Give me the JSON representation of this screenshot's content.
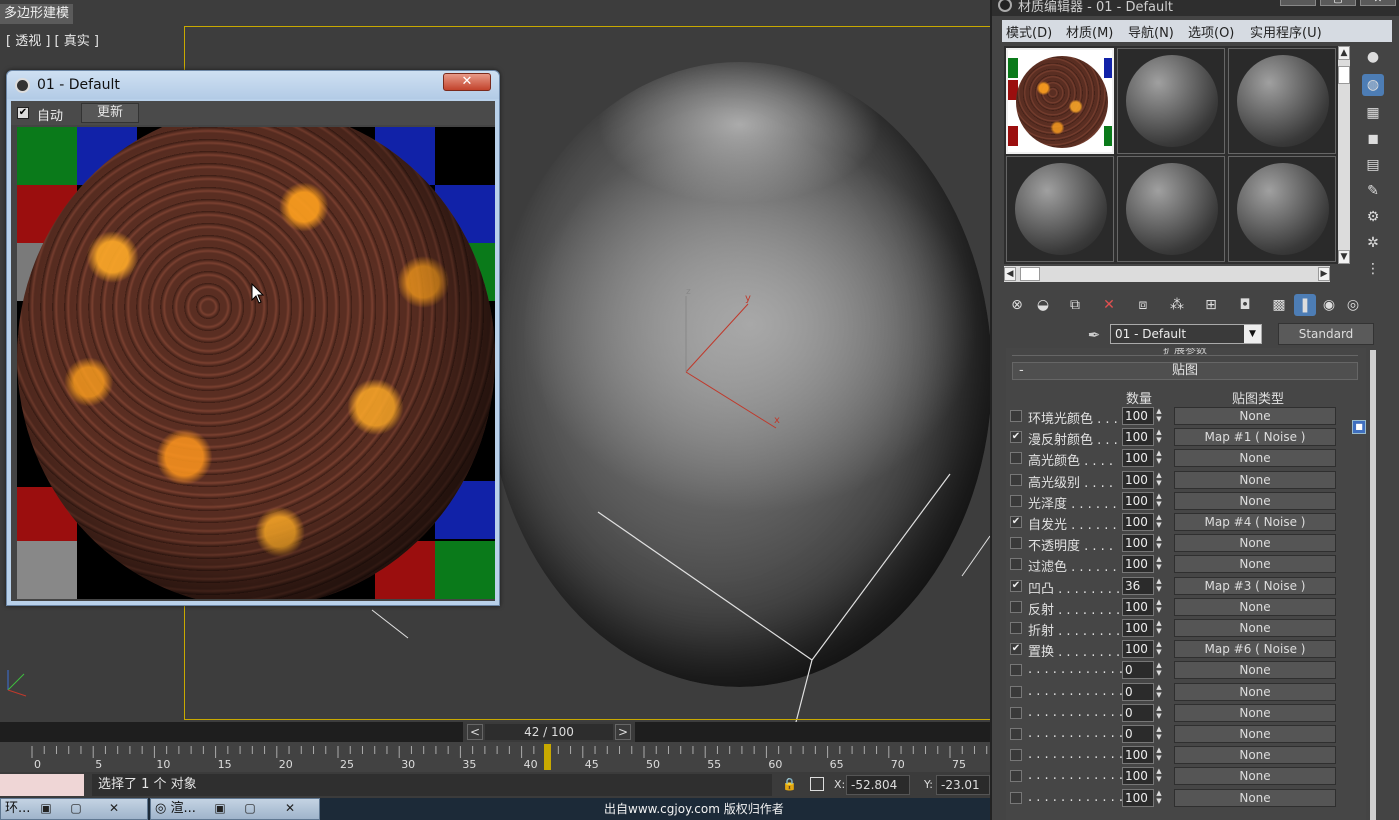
{
  "viewport": {
    "tab_label": "多边形建模",
    "view_label": "[ 透视 ] [ 真实 ]",
    "axis_labels": {
      "x": "x",
      "y": "y",
      "z": "z"
    }
  },
  "preview_window": {
    "title": "01 - Default",
    "close_label": "✕",
    "auto_label": "自动",
    "auto_checked": "✔",
    "update_label": "更新"
  },
  "timeline": {
    "prev": "<",
    "next": ">",
    "frame_display": "42 / 100",
    "current_frame": 42,
    "total_frames": 100,
    "ticks": [
      "0",
      "5",
      "10",
      "15",
      "20",
      "25",
      "30",
      "35",
      "40",
      "45",
      "50",
      "55",
      "60",
      "65",
      "70",
      "75"
    ]
  },
  "status": {
    "message": "选择了 1 个 对象",
    "x_label": "X:",
    "x_value": "-52.804",
    "y_label": "Y:",
    "y_value": "-23.01"
  },
  "taskbar": {
    "task1": "环...",
    "task2": "渲..."
  },
  "watermark": "出自www.cgjoy.com 版权归作者",
  "material_editor": {
    "title": "材质编辑器 - 01 - Default",
    "menus": [
      "模式(D)",
      "材质(M)",
      "导航(N)",
      "选项(O)",
      "实用程序(U)"
    ],
    "material_name": "01 - Default",
    "material_type": "Standard",
    "extended_params": "扩展参数",
    "maps_title": "贴图",
    "maps_collapse": "-",
    "col_amount": "数量",
    "col_maptype": "贴图类型",
    "maps": [
      {
        "checked": false,
        "name": "环境光颜色 . . .",
        "amount": "100",
        "map": "None"
      },
      {
        "checked": true,
        "name": "漫反射颜色 . . .",
        "amount": "100",
        "map": "Map #1  ( Noise )"
      },
      {
        "checked": false,
        "name": "高光颜色 . . . .",
        "amount": "100",
        "map": "None"
      },
      {
        "checked": false,
        "name": "高光级别 . . . .",
        "amount": "100",
        "map": "None"
      },
      {
        "checked": false,
        "name": "光泽度 . . . . . .",
        "amount": "100",
        "map": "None"
      },
      {
        "checked": true,
        "name": "自发光 . . . . . .",
        "amount": "100",
        "map": "Map #4  ( Noise )"
      },
      {
        "checked": false,
        "name": "不透明度 . . . .",
        "amount": "100",
        "map": "None"
      },
      {
        "checked": false,
        "name": "过滤色 . . . . . .",
        "amount": "100",
        "map": "None"
      },
      {
        "checked": true,
        "name": "凹凸 . . . . . . . .",
        "amount": "36",
        "map": "Map #3  ( Noise )"
      },
      {
        "checked": false,
        "name": "反射 . . . . . . . .",
        "amount": "100",
        "map": "None"
      },
      {
        "checked": false,
        "name": "折射 . . . . . . . .",
        "amount": "100",
        "map": "None"
      },
      {
        "checked": true,
        "name": "置换 . . . . . . . .",
        "amount": "100",
        "map": "Map #6  ( Noise )"
      },
      {
        "checked": false,
        "name": ". . . . . . . . . . . .",
        "amount": "0",
        "map": "None"
      },
      {
        "checked": false,
        "name": ". . . . . . . . . . . .",
        "amount": "0",
        "map": "None"
      },
      {
        "checked": false,
        "name": ". . . . . . . . . . . .",
        "amount": "0",
        "map": "None"
      },
      {
        "checked": false,
        "name": ". . . . . . . . . . . .",
        "amount": "0",
        "map": "None"
      },
      {
        "checked": false,
        "name": ". . . . . . . . . . . .",
        "amount": "100",
        "map": "None"
      },
      {
        "checked": false,
        "name": ". . . . . . . . . . . .",
        "amount": "100",
        "map": "None"
      },
      {
        "checked": false,
        "name": ". . . . . . . . . . . .",
        "amount": "100",
        "map": "None"
      }
    ],
    "check_glyph": "✔",
    "lock_glyph": "🔒"
  },
  "colors": {
    "viewport_border": "#c8a900",
    "accent_blue": "#4d7db5",
    "close_red": "#c2432c"
  }
}
